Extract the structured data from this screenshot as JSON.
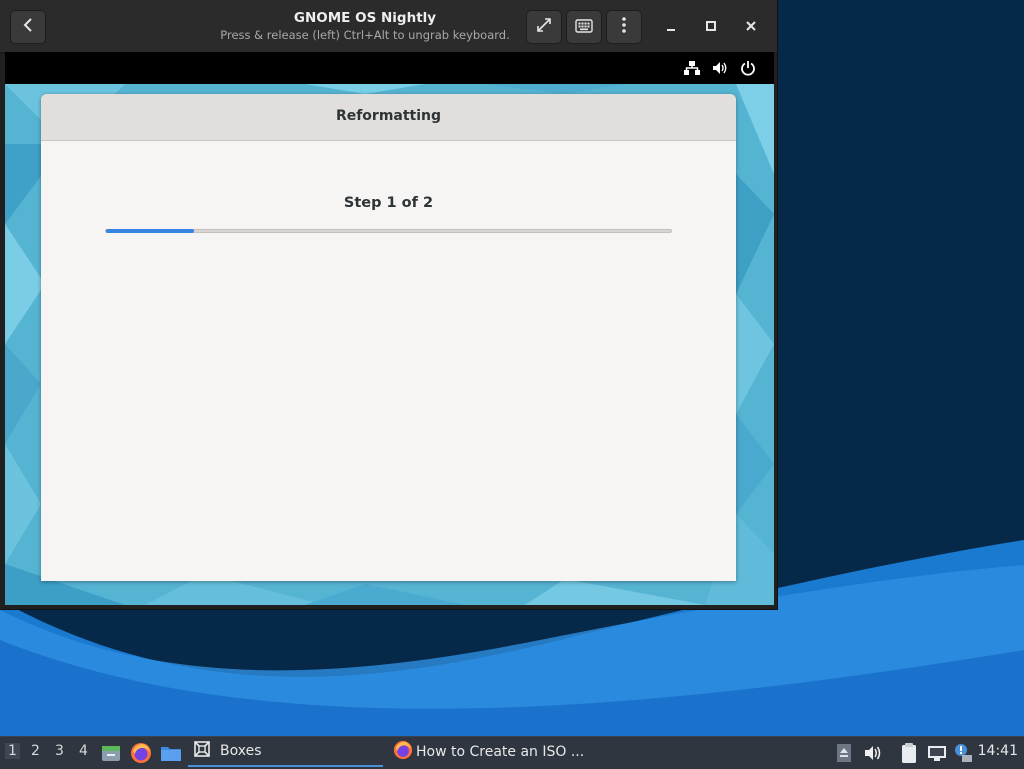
{
  "boxes": {
    "title": "GNOME OS Nightly",
    "subtitle": "Press & release (left) Ctrl+Alt to ungrab keyboard.",
    "icons": {
      "back": "chevron-left-icon",
      "fullscreen": "fullscreen-icon",
      "keyboard": "keyboard-icon",
      "menu": "kebab-menu-icon",
      "minimize": "minimize-icon",
      "maximize": "maximize-icon",
      "close": "close-icon"
    }
  },
  "guest_topbar": {
    "icons": [
      "network-icon",
      "volume-icon",
      "power-icon"
    ]
  },
  "dialog": {
    "title": "Reformatting",
    "step_label": "Step 1 of 2",
    "progress": 0.155,
    "accent": "#3584e4"
  },
  "taskbar": {
    "workspaces": [
      "1",
      "2",
      "3",
      "4"
    ],
    "active_workspace": "1",
    "launchers": [
      "file-manager-icon",
      "firefox-icon",
      "folder-icon"
    ],
    "tasks": [
      {
        "label": "Boxes",
        "icon": "boxes-icon",
        "active": true
      },
      {
        "label": "How to Create an ISO ...",
        "icon": "firefox-icon",
        "active": false
      }
    ],
    "tray": [
      "eject-icon",
      "volume-icon",
      "clipboard-icon",
      "network-icon",
      "notification-icon"
    ],
    "clock": "14:41"
  }
}
